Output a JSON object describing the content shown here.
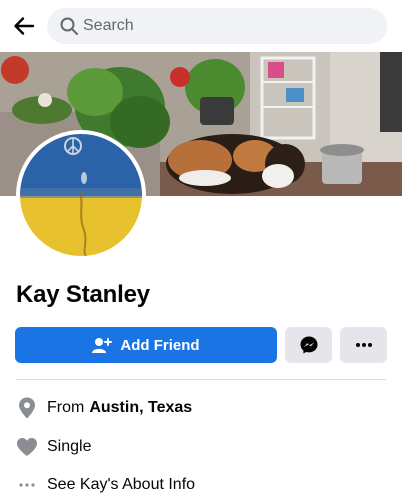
{
  "header": {
    "back_icon": "arrow-left-icon",
    "search_icon": "search-icon",
    "search_placeholder": "Search"
  },
  "profile": {
    "name": "Kay Stanley",
    "cover_photo": "cover-photo",
    "avatar": "profile-picture"
  },
  "actions": {
    "add_friend_label": "Add Friend",
    "add_friend_icon": "add-friend-icon",
    "message_icon": "messenger-icon",
    "more_icon": "more-dots-icon",
    "primary_color": "#1b74e4",
    "secondary_color": "#e4e6eb"
  },
  "intro": {
    "from_prefix": "From",
    "from_location": "Austin, Texas",
    "relationship": "Single",
    "about_link": "See Kay's About Info"
  }
}
